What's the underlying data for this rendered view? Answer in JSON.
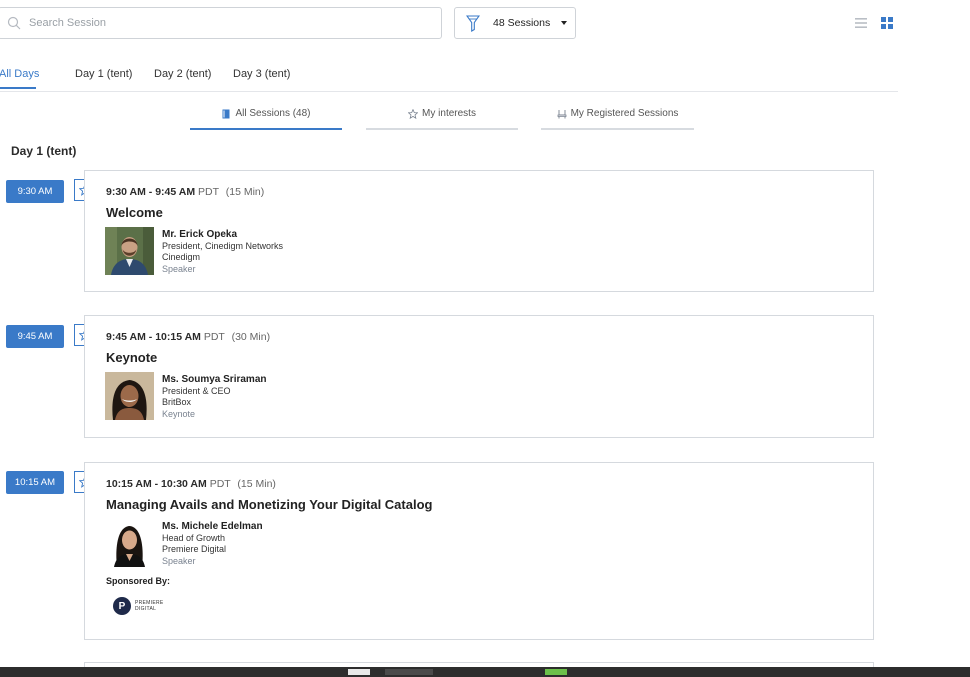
{
  "search": {
    "placeholder": "Search Session"
  },
  "filter": {
    "label": "48 Sessions"
  },
  "day_tabs": [
    {
      "label": "All Days",
      "active": true
    },
    {
      "label": "Day 1 (tent)",
      "active": false
    },
    {
      "label": "Day 2 (tent)",
      "active": false
    },
    {
      "label": "Day 3 (tent)",
      "active": false
    }
  ],
  "sub_tabs": [
    {
      "label": "All Sessions (48)",
      "icon": "book-icon",
      "active": true
    },
    {
      "label": "My interests",
      "icon": "star-outline-icon",
      "active": false
    },
    {
      "label": "My Registered Sessions",
      "icon": "seat-icon",
      "active": false
    }
  ],
  "day_heading": "Day 1 (tent)",
  "sessions": [
    {
      "badge": "9:30 AM",
      "time_range": "9:30 AM - 9:45 AM",
      "tz": "PDT",
      "duration": "(15 Min)",
      "title": "Welcome",
      "speaker": {
        "name": "Mr. Erick Opeka",
        "title": "President, Cinedigm Networks",
        "company": "Cinedigm",
        "role": "Speaker"
      }
    },
    {
      "badge": "9:45 AM",
      "time_range": "9:45 AM - 10:15 AM",
      "tz": "PDT",
      "duration": "(30 Min)",
      "title": "Keynote",
      "speaker": {
        "name": "Ms. Soumya Sriraman",
        "title": "President & CEO",
        "company": "BritBox",
        "role": "Keynote"
      }
    },
    {
      "badge": "10:15 AM",
      "time_range": "10:15 AM - 10:30 AM",
      "tz": "PDT",
      "duration": "(15 Min)",
      "title": "Managing Avails and Monetizing Your Digital Catalog",
      "speaker": {
        "name": "Ms. Michele Edelman",
        "title": "Head of Growth",
        "company": "Premiere Digital",
        "role": "Speaker"
      },
      "sponsored_label": "Sponsored By:",
      "sponsor": {
        "mark": "P",
        "line1": "PREMIERE",
        "line2": "DIGITAL"
      }
    }
  ],
  "colors": {
    "accent": "#3a7ac8",
    "border": "#d5d9de"
  }
}
